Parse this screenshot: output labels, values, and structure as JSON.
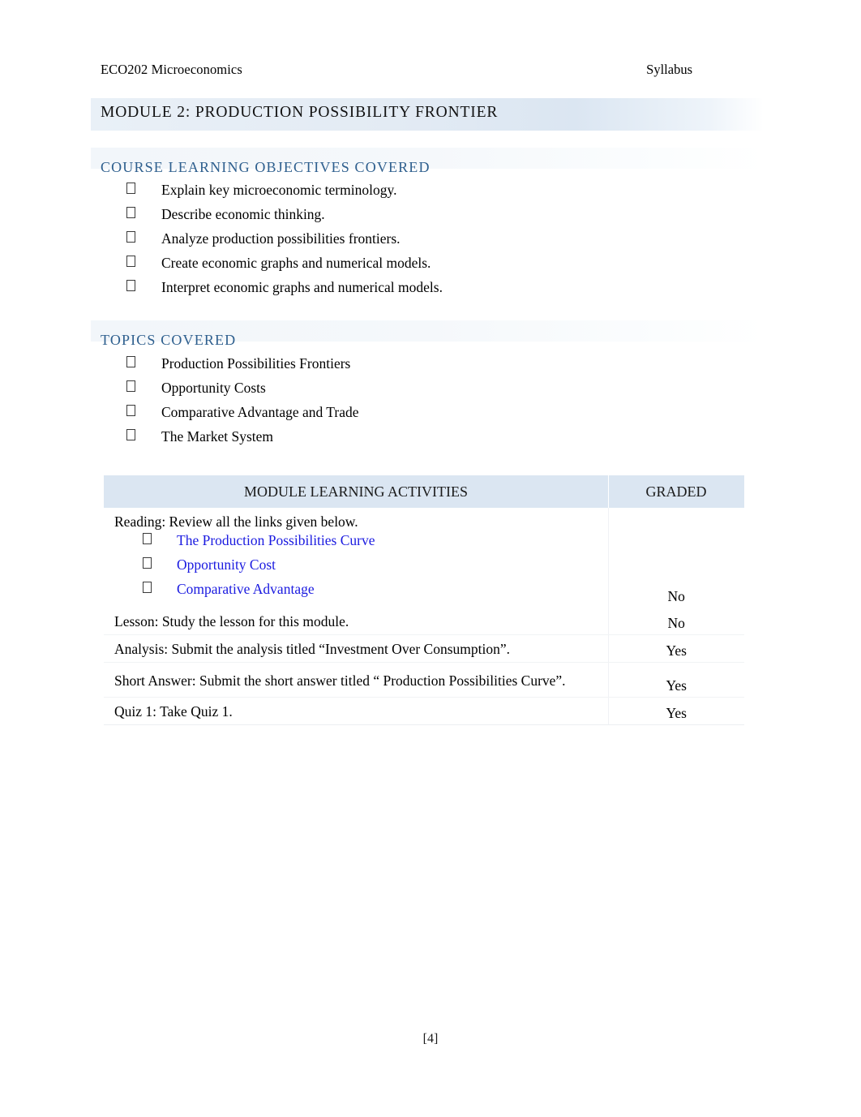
{
  "header": {
    "course": "ECO202 Microeconomics",
    "doc_kind": "Syllabus"
  },
  "module": {
    "title": "MODULE 2: PRODUCTION POSSIBILITY FRONTIER",
    "band_color": "#dbe6f2"
  },
  "sections": {
    "objectives": {
      "heading": "COURSE LEARNING OBJECTIVES COVERED",
      "heading_color": "#2e5f8e",
      "items": [
        "Explain key microeconomic terminology.",
        "Describe economic thinking.",
        "Analyze production possibilities frontiers.",
        "Create economic graphs and numerical models.",
        "Interpret economic graphs and numerical models."
      ]
    },
    "topics": {
      "heading": "TOPICS COVERED",
      "heading_color": "#2e5f8e",
      "items": [
        "Production Possibilities Frontiers",
        "Opportunity Costs",
        "Comparative Advantage and Trade",
        "The Market System"
      ]
    }
  },
  "table": {
    "headers": {
      "activities": "MODULE LEARNING ACTIVITIES",
      "graded": "GRADED"
    },
    "header_bg": "#dbe6f2",
    "link_color": "#1a1ae0",
    "reading": {
      "intro": "Reading:  Review all the links given below.",
      "links": [
        "The Production Possibilities Curve",
        "Opportunity Cost",
        "Comparative Advantage"
      ],
      "graded": "No"
    },
    "rows": [
      {
        "activity": "Lesson: Study the lesson for this module.",
        "graded": "No"
      },
      {
        "activity": "Analysis: Submit the analysis titled “Investment Over Consumption”.",
        "graded": "Yes"
      },
      {
        "activity": "Short Answer:  Submit the short answer titled “ Production Possibilities Curve”.",
        "graded": "Yes"
      },
      {
        "activity": "Quiz 1: Take Quiz 1.",
        "graded": "Yes"
      }
    ]
  },
  "footer": {
    "page_number": "[4]"
  }
}
